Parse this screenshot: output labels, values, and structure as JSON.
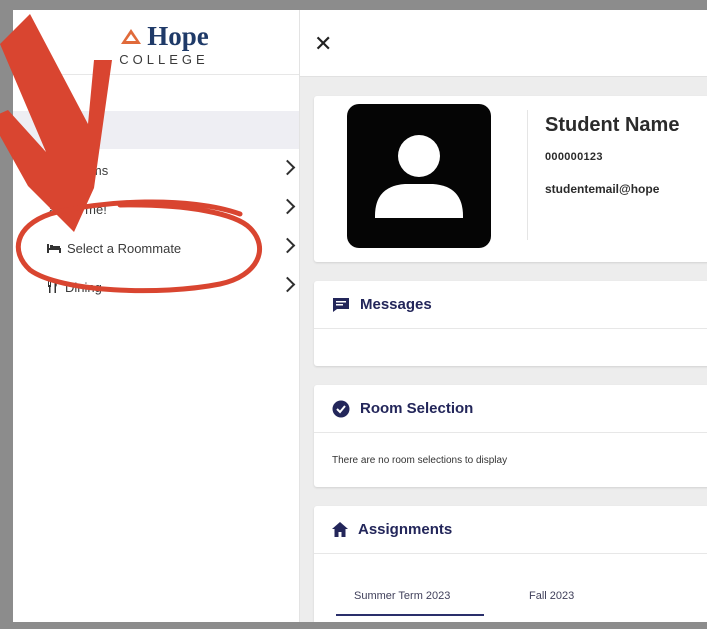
{
  "logo": {
    "word": "Hope",
    "sub": "COLLEGE"
  },
  "sidebar": {
    "items": [
      {
        "label": "e"
      },
      {
        "label": "s & Forms"
      },
      {
        "label": "about me!"
      },
      {
        "label": "Select a Roommate"
      },
      {
        "label": "Dining"
      }
    ]
  },
  "profile": {
    "name": "Student Name",
    "id": "000000123",
    "email": "studentemail@hope"
  },
  "messages": {
    "title": "Messages"
  },
  "room_selection": {
    "title": "Room Selection",
    "empty_text": "There are no room selections to display"
  },
  "assignments": {
    "title": "Assignments",
    "tabs": [
      {
        "label": "Summer Term 2023"
      },
      {
        "label": "Fall 2023"
      }
    ]
  },
  "colors": {
    "brand_navy": "#1f3a68",
    "accent_orange": "#e06a3a",
    "annotation_red": "#d94530",
    "card_title": "#23265a"
  },
  "icons": {
    "close": "close-icon",
    "messages": "chat-icon",
    "room_selection": "check-circle-icon",
    "assignments": "home-icon",
    "roommate": "bed-icon",
    "dining": "fork-knife-icon"
  }
}
